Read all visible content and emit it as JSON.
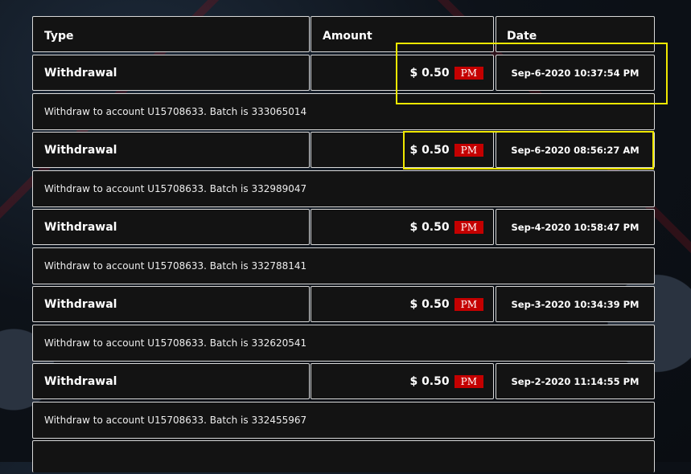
{
  "header": {
    "type": "Type",
    "amount": "Amount",
    "date": "Date"
  },
  "transactions": [
    {
      "type": "Withdrawal",
      "amount": "$ 0.50",
      "currency": "PM",
      "date": "Sep-6-2020 10:37:54 PM",
      "description": "Withdraw to account U15708633. Batch is 333065014"
    },
    {
      "type": "Withdrawal",
      "amount": "$ 0.50",
      "currency": "PM",
      "date": "Sep-6-2020 08:56:27 AM",
      "description": "Withdraw to account U15708633. Batch is 332989047"
    },
    {
      "type": "Withdrawal",
      "amount": "$ 0.50",
      "currency": "PM",
      "date": "Sep-4-2020 10:58:47 PM",
      "description": "Withdraw to account U15708633. Batch is 332788141"
    },
    {
      "type": "Withdrawal",
      "amount": "$ 0.50",
      "currency": "PM",
      "date": "Sep-3-2020 10:34:39 PM",
      "description": "Withdraw to account U15708633. Batch is 332620541"
    },
    {
      "type": "Withdrawal",
      "amount": "$ 0.50",
      "currency": "PM",
      "date": "Sep-2-2020 11:14:55 PM",
      "description": "Withdraw to account U15708633. Batch is 332455967"
    }
  ],
  "colors": {
    "background": "#131313",
    "border": "#d9d9d9",
    "badge": "#c40000",
    "highlight": "#f0e800"
  }
}
